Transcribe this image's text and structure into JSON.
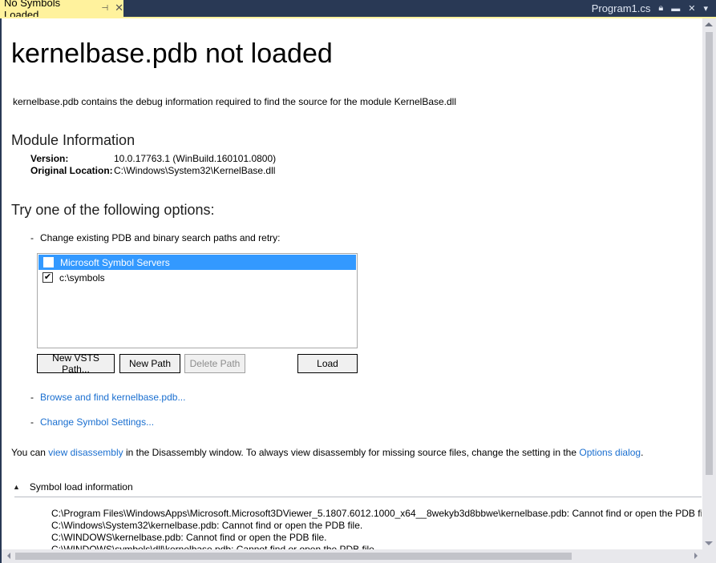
{
  "tabs": {
    "active": {
      "label": "No Symbols Loaded",
      "pin_icon": "pin-icon",
      "close_icon": "close-icon"
    },
    "right": {
      "file": "Program1.cs",
      "icons": [
        "lock-icon",
        "pin-window-icon",
        "close-icon",
        "dropdown-icon"
      ]
    }
  },
  "page": {
    "title": "kernelbase.pdb not loaded",
    "description": "kernelbase.pdb contains the debug information required to find the source for the module KernelBase.dll",
    "module_heading": "Module Information",
    "module": {
      "version_label": "Version:",
      "version_value": "10.0.17763.1 (WinBuild.160101.0800)",
      "location_label": "Original Location:",
      "location_value": "C:\\Windows\\System32\\KernelBase.dll"
    },
    "options_heading": "Try one of the following options:",
    "options": {
      "dash": "-",
      "change_paths": "Change existing PDB and binary search paths and retry:",
      "browse_link": "Browse and find kernelbase.pdb...",
      "settings_link": "Change Symbol Settings..."
    },
    "paths": [
      {
        "label": "Microsoft Symbol Servers",
        "checked": false,
        "selected": true,
        "check_glyph": ""
      },
      {
        "label": "c:\\symbols",
        "checked": true,
        "selected": false,
        "check_glyph": "✔"
      }
    ],
    "buttons": {
      "new_vsts": "New VSTS Path...",
      "new_path": "New Path",
      "delete_path": "Delete Path",
      "load": "Load"
    },
    "note": {
      "pre": "You can ",
      "link1": "view disassembly",
      "mid": " in the Disassembly window. To always view disassembly for missing source files, change the setting in the ",
      "link2": "Options dialog",
      "post": "."
    },
    "symbol_load": {
      "label": "Symbol load information",
      "chevron": "▲",
      "lines": [
        "C:\\Program Files\\WindowsApps\\Microsoft.Microsoft3DViewer_5.1807.6012.1000_x64__8wekyb3d8bbwe\\kernelbase.pdb: Cannot find or open the PDB file.",
        "C:\\Windows\\System32\\kernelbase.pdb: Cannot find or open the PDB file.",
        "C:\\WINDOWS\\kernelbase.pdb: Cannot find or open the PDB file.",
        "C:\\WINDOWS\\symbols\\dll\\kernelbase.pdb: Cannot find or open the PDB file."
      ]
    }
  },
  "colors": {
    "tab_active_bg": "#fff29d",
    "chrome_bg": "#293955",
    "link": "#1a6fd0",
    "selection": "#3399ff"
  }
}
